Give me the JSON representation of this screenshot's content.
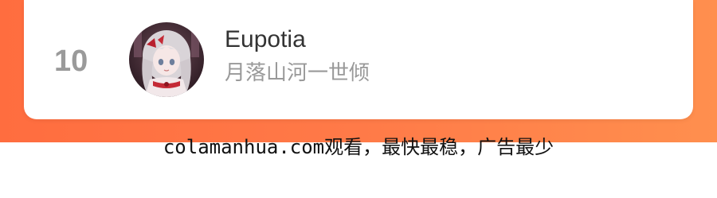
{
  "entry": {
    "rank": "10",
    "name": "Eupotia",
    "subtitle": "月落山河一世倾",
    "avatar_icon": "anime-girl-avatar"
  },
  "footer": {
    "text": "colamanhua.com观看，最快最稳，广告最少"
  },
  "colors": {
    "banner_gradient": [
      "#ff6d3f",
      "#ff8f4e"
    ],
    "card_background": "#ffffff",
    "rank_color": "#9a9a9a",
    "name_color": "#333333",
    "subtitle_color": "#999999"
  }
}
